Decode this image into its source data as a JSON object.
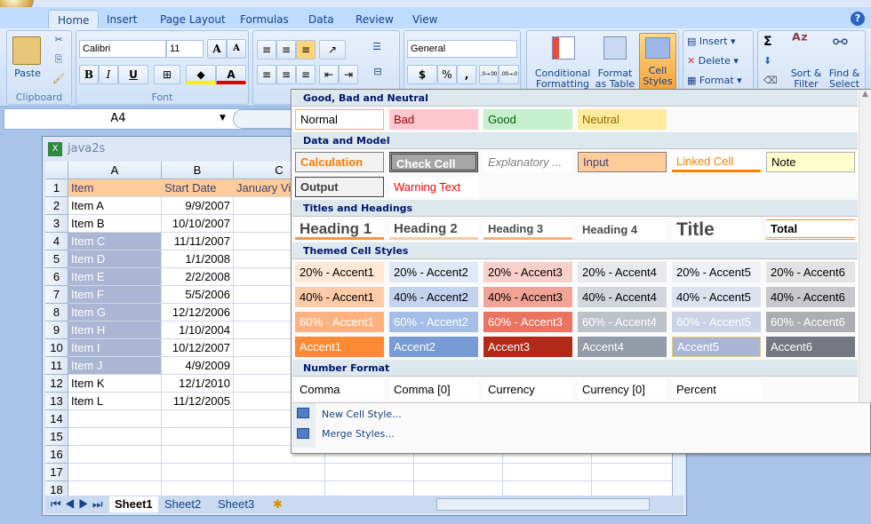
{
  "ribbon": {
    "tabs": [
      "Home",
      "Insert",
      "Page Layout",
      "Formulas",
      "Data",
      "Review",
      "View"
    ],
    "active_tab": "Home",
    "clipboard": {
      "label": "Clipboard",
      "paste": "Paste"
    },
    "font": {
      "label": "Font",
      "name": "Calibri",
      "size": "11",
      "bold": "B",
      "italic": "I",
      "underline": "U",
      "grow": "A",
      "shrink": "A",
      "font_color": "A"
    },
    "number": {
      "format": "General",
      "currency": "$",
      "percent": "%",
      "comma": ",",
      "inc_decimal": ".0→.00",
      "dec_decimal": ".00→.0"
    },
    "styles": {
      "conditional": [
        "Conditional",
        "Formatting"
      ],
      "format_table": [
        "Format",
        "as Table"
      ],
      "cell_styles": [
        "Cell",
        "Styles"
      ]
    },
    "cells": {
      "insert": "Insert",
      "delete": "Delete",
      "format": "Format"
    },
    "editing": {
      "sum": "Σ",
      "sort": [
        "Sort &",
        "Filter"
      ],
      "find": [
        "Find &",
        "Select"
      ]
    }
  },
  "formula_bar": {
    "name_box": "A4"
  },
  "workbook": {
    "title": "java2s",
    "columns": [
      "A",
      "B",
      "C"
    ],
    "header_row": [
      "Item",
      "Start Date",
      "January Vi"
    ],
    "rows": [
      [
        "Item A",
        "9/9/2007"
      ],
      [
        "Item B",
        "10/10/2007"
      ],
      [
        "Item C",
        "11/11/2007"
      ],
      [
        "Item D",
        "1/1/2008"
      ],
      [
        "Item E",
        "2/2/2008"
      ],
      [
        "Item F",
        "5/5/2006"
      ],
      [
        "Item G",
        "12/12/2006"
      ],
      [
        "Item H",
        "1/10/2004"
      ],
      [
        "Item I",
        "10/12/2007"
      ],
      [
        "Item J",
        "4/9/2009"
      ],
      [
        "Item K",
        "12/1/2010"
      ],
      [
        "Item L",
        "11/12/2005"
      ]
    ],
    "row_numbers": [
      1,
      2,
      3,
      4,
      5,
      6,
      7,
      8,
      9,
      10,
      11,
      12,
      13,
      14,
      15,
      16,
      17,
      18
    ],
    "selected_range": "A4:A11",
    "sheets": [
      "Sheet1",
      "Sheet2",
      "Sheet3"
    ],
    "active_sheet": "Sheet1"
  },
  "gallery": {
    "sections": [
      {
        "title": "Good, Bad and Neutral",
        "rows": [
          [
            {
              "label": "Normal",
              "bg": "#FFFFFF",
              "fg": "#000000",
              "border": "#F2B75B"
            },
            {
              "label": "Bad",
              "bg": "#FFC7CE",
              "fg": "#9C0006"
            },
            {
              "label": "Good",
              "bg": "#C6EFCE",
              "fg": "#006100"
            },
            {
              "label": "Neutral",
              "bg": "#FFEB9C",
              "fg": "#9C6500"
            }
          ]
        ]
      },
      {
        "title": "Data and Model",
        "rows": [
          [
            {
              "label": "Calculation",
              "bg": "#F2F2F2",
              "fg": "#FA7D00",
              "border": "#7F7F7F",
              "bold": true
            },
            {
              "label": "Check Cell",
              "bg": "#A5A5A5",
              "fg": "#FFFFFF",
              "border": "#3F3F3F",
              "bold": true,
              "double": true
            },
            {
              "label": "Explanatory ...",
              "bg": "#FFFFFF",
              "fg": "#7F7F7F",
              "italic": true
            },
            {
              "label": "Input",
              "bg": "#FFCC99",
              "fg": "#3F3F76",
              "border": "#7F7F7F"
            },
            {
              "label": "Linked Cell",
              "bg": "#FFFFFF",
              "fg": "#FA7D00",
              "underline": "#FF8001"
            },
            {
              "label": "Note",
              "bg": "#FFFFCC",
              "fg": "#000000",
              "border": "#B2B2B2"
            }
          ],
          [
            {
              "label": "Output",
              "bg": "#F2F2F2",
              "fg": "#3F3F3F",
              "border": "#3F3F3F",
              "bold": true
            },
            {
              "label": "Warning Text",
              "bg": "#FFFFFF",
              "fg": "#FF0000"
            }
          ]
        ]
      },
      {
        "title": "Titles and Headings",
        "rows": [
          [
            {
              "label": "Heading 1",
              "bg": "#FFFFFF",
              "fg": "#4A4A4A",
              "bold": true,
              "size": 17,
              "underline": "#F79646"
            },
            {
              "label": "Heading 2",
              "bg": "#FFFFFF",
              "fg": "#4A4A4A",
              "bold": true,
              "size": 15,
              "underline": "#FBCBA3"
            },
            {
              "label": "Heading 3",
              "bg": "#FFFFFF",
              "fg": "#4A4A4A",
              "bold": true,
              "size": 13,
              "underline": "#FCB07A"
            },
            {
              "label": "Heading 4",
              "bg": "#FFFFFF",
              "fg": "#4A4A4A",
              "bold": true,
              "size": 13
            },
            {
              "label": "Title",
              "bg": "#FFFFFF",
              "fg": "#4A4A4A",
              "bold": true,
              "size": 21,
              "serif": true
            },
            {
              "label": "Total",
              "bg": "#FFFFFF",
              "fg": "#000000",
              "bold": true,
              "total": "#F79646"
            }
          ]
        ]
      },
      {
        "title": "Themed Cell Styles",
        "rows": [
          [
            {
              "label": "20% - Accent1",
              "bg": "#FFE6D5",
              "fg": "#000"
            },
            {
              "label": "20% - Accent2",
              "bg": "#E1E8F7",
              "fg": "#000"
            },
            {
              "label": "20% - Accent3",
              "bg": "#F8D0CA",
              "fg": "#000"
            },
            {
              "label": "20% - Accent4",
              "bg": "#E8E9EC",
              "fg": "#000"
            },
            {
              "label": "20% - Accent5",
              "bg": "#EEF0F6",
              "fg": "#000"
            },
            {
              "label": "20% - Accent6",
              "bg": "#E3E3E5",
              "fg": "#000"
            }
          ],
          [
            {
              "label": "40% - Accent1",
              "bg": "#FFCCAA",
              "fg": "#000"
            },
            {
              "label": "40% - Accent2",
              "bg": "#C3D3EF",
              "fg": "#000"
            },
            {
              "label": "40% - Accent3",
              "bg": "#F1A396",
              "fg": "#000"
            },
            {
              "label": "40% - Accent4",
              "bg": "#D2D5DB",
              "fg": "#000"
            },
            {
              "label": "40% - Accent5",
              "bg": "#DEE2EE",
              "fg": "#000"
            },
            {
              "label": "40% - Accent6",
              "bg": "#C8C8CC",
              "fg": "#000"
            }
          ],
          [
            {
              "label": "60% - Accent1",
              "bg": "#FFB27F",
              "fg": "#FFF"
            },
            {
              "label": "60% - Accent2",
              "bg": "#A5BEE7",
              "fg": "#FFF"
            },
            {
              "label": "60% - Accent3",
              "bg": "#EA7460",
              "fg": "#FFF"
            },
            {
              "label": "60% - Accent4",
              "bg": "#BDC1CA",
              "fg": "#FFF"
            },
            {
              "label": "60% - Accent5",
              "bg": "#CDD3E6",
              "fg": "#FFF"
            },
            {
              "label": "60% - Accent6",
              "bg": "#ADAEB2",
              "fg": "#FFF"
            }
          ],
          [
            {
              "label": "Accent1",
              "bg": "#FF8A35",
              "fg": "#FFF"
            },
            {
              "label": "Accent2",
              "bg": "#789BD6",
              "fg": "#FFF"
            },
            {
              "label": "Accent3",
              "bg": "#B12A17",
              "fg": "#FFF"
            },
            {
              "label": "Accent4",
              "bg": "#949BA8",
              "fg": "#FFF"
            },
            {
              "label": "Accent5",
              "bg": "#AAB5D6",
              "fg": "#FFF",
              "border": "#E6CF80"
            },
            {
              "label": "Accent6",
              "bg": "#757880",
              "fg": "#FFF"
            }
          ]
        ]
      },
      {
        "title": "Number Format",
        "rows": [
          [
            {
              "label": "Comma",
              "bg": "#FFFFFF",
              "fg": "#000"
            },
            {
              "label": "Comma [0]",
              "bg": "#FFFFFF",
              "fg": "#000"
            },
            {
              "label": "Currency",
              "bg": "#FFFFFF",
              "fg": "#000"
            },
            {
              "label": "Currency [0]",
              "bg": "#FFFFFF",
              "fg": "#000"
            },
            {
              "label": "Percent",
              "bg": "#FFFFFF",
              "fg": "#000"
            }
          ]
        ]
      }
    ],
    "menu": {
      "new_style": "New Cell Style...",
      "merge_styles": "Merge Styles..."
    }
  }
}
